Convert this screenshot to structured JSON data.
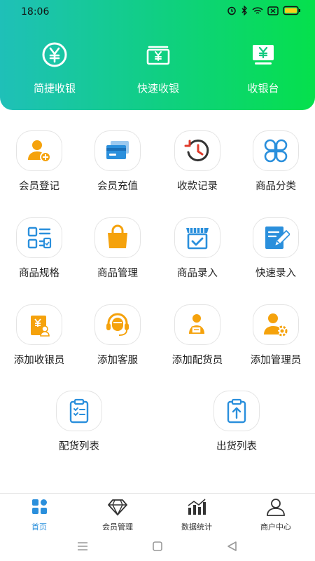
{
  "status_bar": {
    "time": "18:06"
  },
  "quick_actions": [
    {
      "label": "简捷收银",
      "icon": "yuan-circle-icon"
    },
    {
      "label": "快速收银",
      "icon": "yuan-tray-icon"
    },
    {
      "label": "收银台",
      "icon": "yuan-monitor-icon"
    }
  ],
  "grid": [
    {
      "label": "会员登记",
      "icon": "add-member-icon"
    },
    {
      "label": "会员充值",
      "icon": "card-icon"
    },
    {
      "label": "收款记录",
      "icon": "history-icon"
    },
    {
      "label": "商品分类",
      "icon": "category-icon"
    },
    {
      "label": "商品规格",
      "icon": "spec-list-icon"
    },
    {
      "label": "商品管理",
      "icon": "shopping-bag-icon"
    },
    {
      "label": "商品录入",
      "icon": "store-check-icon"
    },
    {
      "label": "快速录入",
      "icon": "edit-note-icon"
    },
    {
      "label": "添加收银员",
      "icon": "cashier-icon"
    },
    {
      "label": "添加客服",
      "icon": "headset-icon"
    },
    {
      "label": "添加配货员",
      "icon": "delivery-person-icon"
    },
    {
      "label": "添加管理员",
      "icon": "admin-gear-icon"
    },
    {
      "label": "配货列表",
      "icon": "clipboard-list-icon"
    },
    {
      "label": "出货列表",
      "icon": "clipboard-upload-icon"
    }
  ],
  "tabbar": [
    {
      "label": "首页",
      "icon": "home-grid-icon",
      "active": true
    },
    {
      "label": "会员管理",
      "icon": "diamond-icon",
      "active": false
    },
    {
      "label": "数据统计",
      "icon": "bar-chart-icon",
      "active": false
    },
    {
      "label": "商户中心",
      "icon": "user-icon",
      "active": false
    }
  ],
  "colors": {
    "header_start": "#1fc0b8",
    "header_end": "#05e04c",
    "orange": "#f5a20c",
    "blue": "#2a8fdc",
    "red": "#e03b2b"
  }
}
